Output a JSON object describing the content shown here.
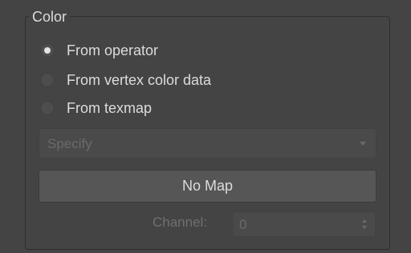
{
  "group": {
    "title": "Color"
  },
  "radios": [
    {
      "label": "From operator",
      "checked": true
    },
    {
      "label": "From vertex color data",
      "checked": false
    },
    {
      "label": "From texmap",
      "checked": false
    }
  ],
  "dropdown": {
    "value": "Specify",
    "disabled": true
  },
  "map_button": {
    "label": "No Map"
  },
  "channel": {
    "label": "Channel:",
    "value": "0",
    "disabled": true
  },
  "colors": {
    "panel_bg": "#444444",
    "text": "#dcdcdc",
    "disabled_text": "#6a6a6a"
  }
}
